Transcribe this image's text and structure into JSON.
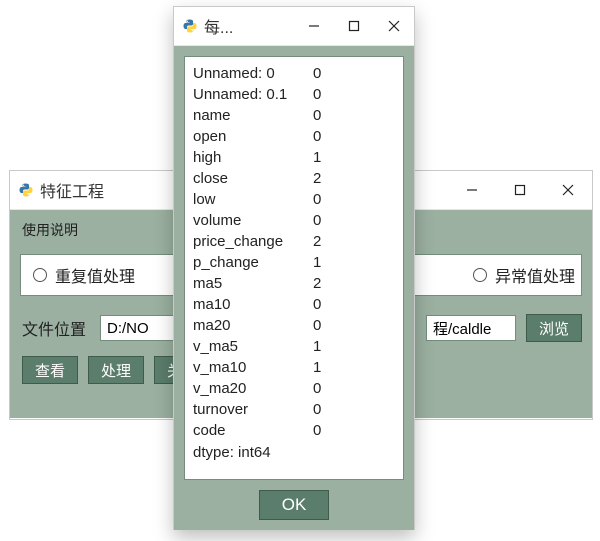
{
  "back": {
    "title": "特征工程",
    "hint": "使用说明",
    "options": {
      "left": "重复值处理",
      "right": "异常值处理"
    },
    "file_label": "文件位置",
    "file_left_value": "D:/NO",
    "file_right_value": "程/caldle",
    "browse": "浏览",
    "buttons": {
      "view": "查看",
      "process": "处理",
      "close": "关"
    }
  },
  "front": {
    "title": "每...",
    "series": [
      {
        "name": "Unnamed: 0",
        "value": "0"
      },
      {
        "name": "Unnamed: 0.1",
        "value": "0"
      },
      {
        "name": "name",
        "value": "0"
      },
      {
        "name": "open",
        "value": "0"
      },
      {
        "name": "high",
        "value": "1"
      },
      {
        "name": "close",
        "value": "2"
      },
      {
        "name": "low",
        "value": "0"
      },
      {
        "name": "volume",
        "value": "0"
      },
      {
        "name": "price_change",
        "value": "2"
      },
      {
        "name": "p_change",
        "value": "1"
      },
      {
        "name": "ma5",
        "value": "2"
      },
      {
        "name": "ma10",
        "value": "0"
      },
      {
        "name": "ma20",
        "value": "0"
      },
      {
        "name": "v_ma5",
        "value": "1"
      },
      {
        "name": "v_ma10",
        "value": "1"
      },
      {
        "name": "v_ma20",
        "value": "0"
      },
      {
        "name": "turnover",
        "value": "0"
      },
      {
        "name": "code",
        "value": "0"
      }
    ],
    "dtype": "dtype: int64",
    "ok": "OK"
  }
}
